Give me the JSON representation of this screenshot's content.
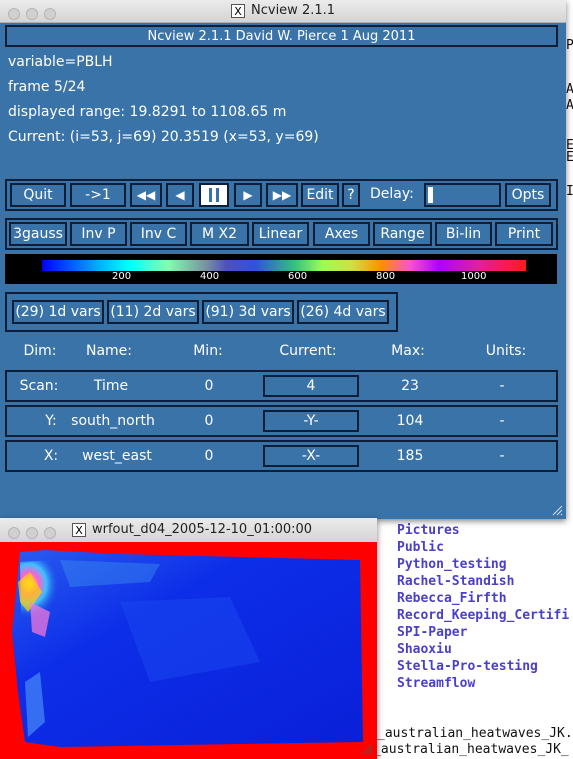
{
  "terminal": {
    "directories": [
      "Pictures",
      "Public",
      "Python_testing",
      "Rachel-Standish",
      "Rebecca_Firfth",
      "Record_Keeping_Certifi",
      "SPI-Paper",
      "Shaoxiu",
      "Stella-Pro-testing",
      "Streamflow"
    ],
    "bottom_lines": [
      "_australian_heatwaves_JK.",
      "herold_etal_australian_heatwaves_JK_"
    ],
    "right_fragments": [
      "P",
      "A",
      "A",
      "E",
      "E",
      "I"
    ]
  },
  "ncview": {
    "window_title": "Ncview 2.1.1",
    "banner": "Ncview 2.1.1 David W. Pierce  1 Aug 2011",
    "variable": "variable=PBLH",
    "frame": "frame 5/24",
    "range": "displayed range: 19.8291 to 1108.65 m",
    "current": "Current: (i=53, j=69) 20.3519 (x=53, y=69)",
    "controls": {
      "quit": "Quit",
      "to_first": "->1",
      "rewind": "◀◀",
      "back": "◀",
      "play": "▶",
      "fast_forward": "▶▶",
      "edit": "Edit",
      "help": "?",
      "delay_label": "Delay:",
      "opts": "Opts"
    },
    "options": [
      "3gauss",
      "Inv P",
      "Inv C",
      "M X2",
      "Linear",
      "Axes",
      "Range",
      "Bi-lin",
      "Print"
    ],
    "colorbar_labels": [
      "200",
      "400",
      "600",
      "800",
      "1000"
    ],
    "var_groups": [
      "(29) 1d vars",
      "(11) 2d vars",
      "(91) 3d vars",
      "(26) 4d vars"
    ],
    "dim_headers": {
      "dim": "Dim:",
      "name": "Name:",
      "min": "Min:",
      "current": "Current:",
      "max": "Max:",
      "units": "Units:"
    },
    "dims": [
      {
        "dim": "Scan:",
        "name": "Time",
        "min": "0",
        "current": "4",
        "max": "23",
        "units": "-"
      },
      {
        "dim": "Y:",
        "name": "south_north",
        "min": "0",
        "current": "-Y-",
        "max": "104",
        "units": "-"
      },
      {
        "dim": "X:",
        "name": "west_east",
        "min": "0",
        "current": "-X-",
        "max": "185",
        "units": "-"
      }
    ],
    "colors": {
      "panel_bg": "#3a73a8",
      "border": "#0d1e36"
    }
  },
  "wrf_window": {
    "title": "wrfout_d04_2005-12-10_01:00:00",
    "colors": {
      "missing": "#ff0000",
      "low": "#0a28e6"
    }
  }
}
